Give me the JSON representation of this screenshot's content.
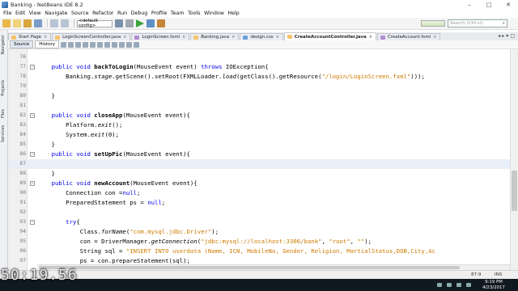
{
  "window": {
    "title": "Banking - NetBeans IDE 8.2",
    "controls": [
      "–",
      "□",
      "✕"
    ]
  },
  "menu": [
    "File",
    "Edit",
    "View",
    "Navigate",
    "Source",
    "Refactor",
    "Run",
    "Debug",
    "Profile",
    "Team",
    "Tools",
    "Window",
    "Help"
  ],
  "toolbar": {
    "config": "<default config>",
    "search_placeholder": "Search (Ctrl+I)"
  },
  "dock": [
    "Navigator",
    "Projects",
    "Files",
    "Services"
  ],
  "tabs": [
    {
      "label": "Start Page",
      "type": "java"
    },
    {
      "label": "LoginScreenController.java",
      "type": "java"
    },
    {
      "label": "LoginScreen.fxml",
      "type": "fxml"
    },
    {
      "label": "Banking.java",
      "type": "java"
    },
    {
      "label": "design.css",
      "type": "css"
    },
    {
      "label": "CreateAccountController.java",
      "type": "java",
      "active": true
    },
    {
      "label": "CreateAccount.fxml",
      "type": "fxml"
    }
  ],
  "source_tabs": [
    "Source",
    "History"
  ],
  "code_lines": [
    {
      "n": "76",
      "fold": false,
      "tokens": []
    },
    {
      "n": "77",
      "fold": true,
      "tokens": [
        [
          "    ",
          ""
        ],
        [
          "public void ",
          "kw"
        ],
        [
          "backToLogin",
          "bold"
        ],
        [
          "(MouseEvent event) ",
          ""
        ],
        [
          "throws ",
          "kw"
        ],
        [
          "IOException{",
          ""
        ]
      ]
    },
    {
      "n": "78",
      "fold": false,
      "tokens": [
        [
          "        Banking.",
          ""
        ],
        [
          "stage",
          "it"
        ],
        [
          ".getScene().setRoot(FXMLLoader.",
          ""
        ],
        [
          "load",
          "it"
        ],
        [
          "(getClass().getResource(",
          ""
        ],
        [
          "\"/login/LoginScreen.fxml\"",
          "str"
        ],
        [
          ")));",
          ""
        ]
      ]
    },
    {
      "n": "79",
      "fold": false,
      "tokens": []
    },
    {
      "n": "80",
      "fold": false,
      "tokens": [
        [
          "    }",
          ""
        ]
      ]
    },
    {
      "n": "81",
      "fold": false,
      "tokens": []
    },
    {
      "n": "82",
      "fold": true,
      "tokens": [
        [
          "    ",
          ""
        ],
        [
          "public void ",
          "kw"
        ],
        [
          "closeApp",
          "bold"
        ],
        [
          "(MouseEvent event){",
          ""
        ]
      ]
    },
    {
      "n": "83",
      "fold": false,
      "tokens": [
        [
          "        Platform.",
          ""
        ],
        [
          "exit",
          "it"
        ],
        [
          "();",
          ""
        ]
      ]
    },
    {
      "n": "84",
      "fold": false,
      "tokens": [
        [
          "        System.",
          ""
        ],
        [
          "exit",
          "it"
        ],
        [
          "(0);",
          ""
        ]
      ]
    },
    {
      "n": "85",
      "fold": false,
      "tokens": [
        [
          "    }",
          ""
        ]
      ]
    },
    {
      "n": "86",
      "fold": true,
      "tokens": [
        [
          "    ",
          ""
        ],
        [
          "public void ",
          "kw"
        ],
        [
          "setUpPic",
          "bold"
        ],
        [
          "(MouseEvent event){",
          ""
        ]
      ]
    },
    {
      "n": "87",
      "fold": false,
      "hl": true,
      "tokens": []
    },
    {
      "n": "88",
      "fold": false,
      "tokens": [
        [
          "    }",
          ""
        ]
      ]
    },
    {
      "n": "89",
      "fold": true,
      "tokens": [
        [
          "    ",
          ""
        ],
        [
          "public void ",
          "kw"
        ],
        [
          "newAccount",
          "bold"
        ],
        [
          "(MouseEvent event){",
          ""
        ]
      ]
    },
    {
      "n": "90",
      "fold": false,
      "tokens": [
        [
          "        Connection con =",
          ""
        ],
        [
          "null",
          "kw"
        ],
        [
          ";",
          ""
        ]
      ]
    },
    {
      "n": "91",
      "fold": false,
      "tokens": [
        [
          "        PreparedStatement ps = ",
          ""
        ],
        [
          "null",
          "kw"
        ],
        [
          ";",
          ""
        ]
      ]
    },
    {
      "n": "92",
      "fold": false,
      "tokens": []
    },
    {
      "n": "93",
      "fold": true,
      "tokens": [
        [
          "        ",
          ""
        ],
        [
          "try",
          "kw"
        ],
        [
          "{",
          ""
        ]
      ]
    },
    {
      "n": "94",
      "fold": false,
      "tokens": [
        [
          "            Class.",
          ""
        ],
        [
          "forName",
          "it"
        ],
        [
          "(",
          ""
        ],
        [
          "\"com.mysql.jdbc.Driver\"",
          "str"
        ],
        [
          ");",
          ""
        ]
      ]
    },
    {
      "n": "95",
      "fold": false,
      "tokens": [
        [
          "            con = DriverManager.",
          ""
        ],
        [
          "getConnection",
          "it"
        ],
        [
          "(",
          ""
        ],
        [
          "\"jdbc:mysql://localhost:3306/bank\"",
          "str"
        ],
        [
          ", ",
          ""
        ],
        [
          "\"root\"",
          "str"
        ],
        [
          ", ",
          ""
        ],
        [
          "\"\"",
          "str"
        ],
        [
          ");",
          ""
        ]
      ]
    },
    {
      "n": "96",
      "fold": false,
      "tokens": [
        [
          "            String sql = ",
          ""
        ],
        [
          "\"INSERT INTO userdata (Name, ICN, MobileNo, Gender, Religion, MartialStatus,DOB,City,Ac",
          "str"
        ]
      ]
    },
    {
      "n": "97",
      "fold": false,
      "tokens": [
        [
          "            ps = con.prepareStatement(sql);",
          ""
        ]
      ]
    }
  ],
  "status": {
    "position": "87:9",
    "mode": "INS"
  },
  "taskbar": {
    "time": "9:19 PM",
    "date": "4/23/2017"
  },
  "overlay": {
    "timestamp": "50:19.56"
  }
}
